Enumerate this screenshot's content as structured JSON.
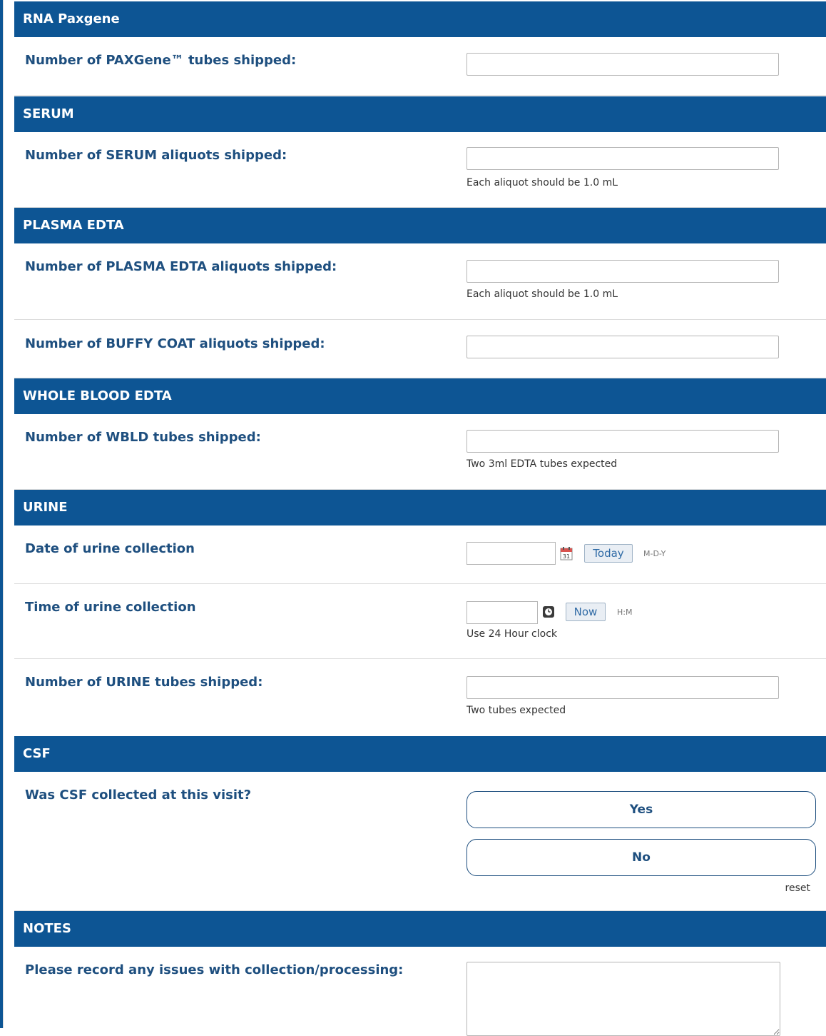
{
  "sections": {
    "rna": {
      "title": "RNA Paxgene"
    },
    "serum": {
      "title": "SERUM"
    },
    "plasma": {
      "title": "PLASMA EDTA"
    },
    "wbld": {
      "title": "WHOLE BLOOD EDTA"
    },
    "urine": {
      "title": "URINE"
    },
    "csf": {
      "title": "CSF"
    },
    "notes": {
      "title": "NOTES"
    }
  },
  "fields": {
    "paxgene_tubes": {
      "label": "Number of PAXGene™ tubes shipped:",
      "value": ""
    },
    "serum_aliquots": {
      "label": "Number of SERUM aliquots shipped:",
      "value": "",
      "note": "Each aliquot should be 1.0 mL"
    },
    "plasma_aliquots": {
      "label": "Number of PLASMA EDTA aliquots shipped:",
      "value": "",
      "note": "Each aliquot should be 1.0 mL"
    },
    "buffy_aliquots": {
      "label": "Number of BUFFY COAT aliquots shipped:",
      "value": ""
    },
    "wbld_tubes": {
      "label": "Number of WBLD tubes shipped:",
      "value": "",
      "note": "Two 3ml EDTA tubes expected"
    },
    "urine_date": {
      "label": "Date of urine collection",
      "value": "",
      "button": "Today",
      "format": "M-D-Y"
    },
    "urine_time": {
      "label": "Time of urine collection",
      "value": "",
      "button": "Now",
      "format": "H:M",
      "note": "Use 24 Hour clock"
    },
    "urine_tubes": {
      "label": "Number of URINE tubes shipped:",
      "value": "",
      "note": "Two tubes expected"
    },
    "csf_collected": {
      "label": "Was CSF collected at this visit?",
      "yes": "Yes",
      "no": "No",
      "reset": "reset"
    },
    "issues": {
      "label": "Please record any issues with collection/processing:",
      "value": ""
    }
  },
  "colors": {
    "header_bg": "#0d5594",
    "label_text": "#1e4f7f"
  },
  "icons": {
    "date_picker": "calendar-icon",
    "time_picker": "clock-icon"
  }
}
